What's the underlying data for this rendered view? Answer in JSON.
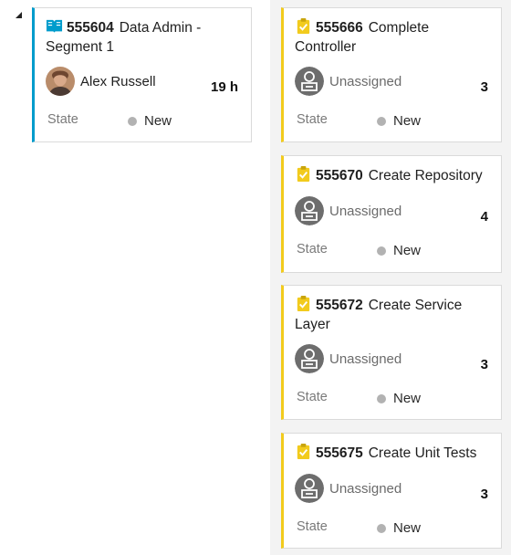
{
  "parent_card": {
    "icon": "book-icon",
    "id": "555604",
    "title": "Data Admin - Segment 1",
    "assignee": "Alex Russell",
    "remaining": "19 h",
    "state_label": "State",
    "state": "New",
    "accent_color": "#009ccc"
  },
  "task_cards": [
    {
      "icon": "clipboard-check-icon",
      "id": "555666",
      "title": "Complete Controller",
      "assignee": "Unassigned",
      "count": "3",
      "state_label": "State",
      "state": "New"
    },
    {
      "icon": "clipboard-check-icon",
      "id": "555670",
      "title": "Create Repository",
      "assignee": "Unassigned",
      "count": "4",
      "state_label": "State",
      "state": "New"
    },
    {
      "icon": "clipboard-check-icon",
      "id": "555672",
      "title": "Create Service Layer",
      "assignee": "Unassigned",
      "count": "3",
      "state_label": "State",
      "state": "New"
    },
    {
      "icon": "clipboard-check-icon",
      "id": "555675",
      "title": "Create Unit Tests",
      "assignee": "Unassigned",
      "count": "3",
      "state_label": "State",
      "state": "New"
    }
  ],
  "colors": {
    "task_accent": "#f2cb1d",
    "state_new_dot": "#b2b2b2",
    "lane_background": "#f3f3f3"
  }
}
